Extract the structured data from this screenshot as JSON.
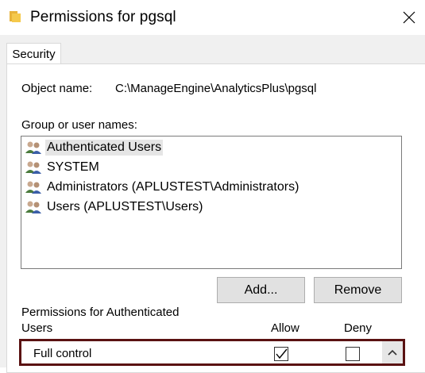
{
  "window": {
    "title": "Permissions for pgsql",
    "folder_icon": "folder-icon",
    "close_icon": "close-icon"
  },
  "tabs": [
    {
      "label": "Security"
    }
  ],
  "object": {
    "label": "Object name:",
    "value": "C:\\ManageEngine\\AnalyticsPlus\\pgsql"
  },
  "groups": {
    "label": "Group or user names:",
    "items": [
      {
        "label": "Authenticated Users",
        "icon": "users-icon",
        "selected": true
      },
      {
        "label": "SYSTEM",
        "icon": "users-icon"
      },
      {
        "label": "Administrators (APLUSTEST\\Administrators)",
        "icon": "users-icon"
      },
      {
        "label": "Users (APLUSTEST\\Users)",
        "icon": "users-icon"
      }
    ]
  },
  "buttons": {
    "add_label": "Add...",
    "remove_label": "Remove"
  },
  "permissions": {
    "header_line1": "Permissions for Authenticated",
    "header_line2": "Users",
    "allow_label": "Allow",
    "deny_label": "Deny",
    "rows": [
      {
        "name": "Full control",
        "allow": true,
        "deny": false
      }
    ]
  },
  "colors": {
    "highlight_border": "#5a1212",
    "selection": "#e5e5e5"
  }
}
